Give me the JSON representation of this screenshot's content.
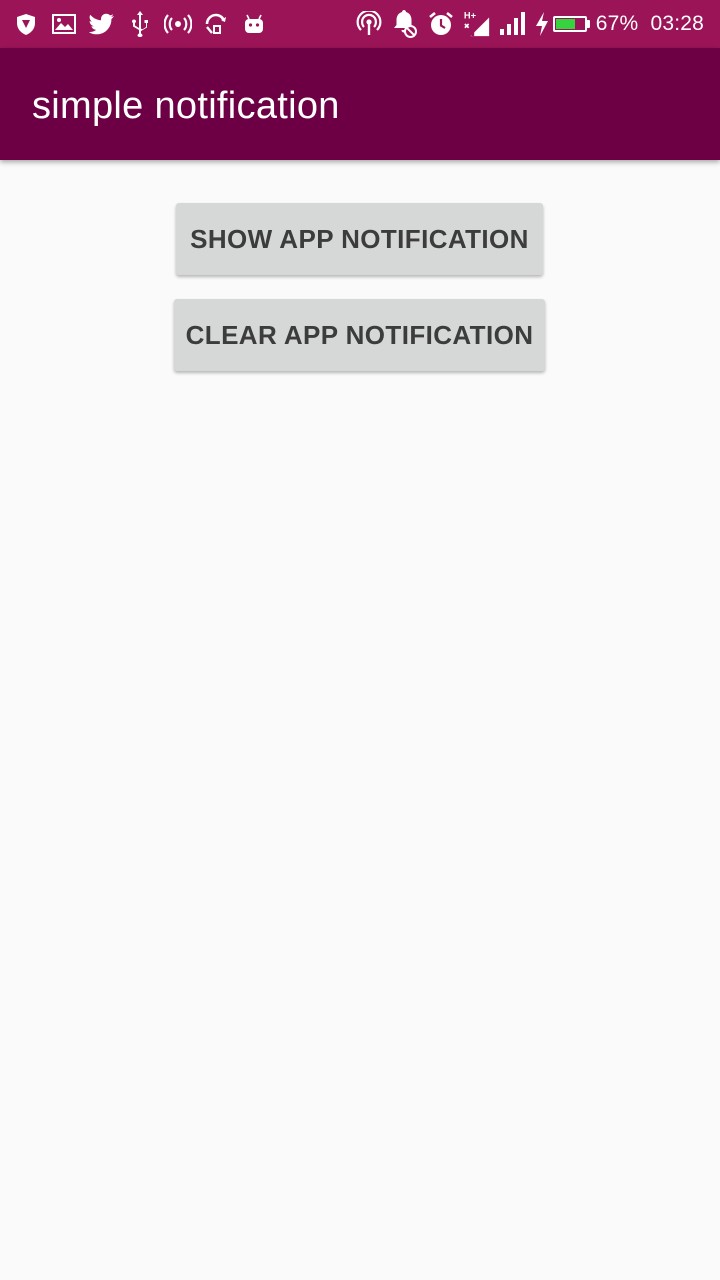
{
  "status_bar": {
    "left_icons": [
      "shield-icon",
      "image-icon",
      "twitter-icon",
      "usb-icon",
      "hotspot-icon",
      "sync-icon",
      "android-icon"
    ],
    "right_icons": [
      "nfc-icon",
      "notifications-off-icon",
      "alarm-icon",
      "hplus-signal-icon",
      "signal-icon",
      "charging-icon"
    ],
    "battery_level": 67,
    "battery_text": "67%",
    "time": "03:28",
    "battery_fill_color": "#35d43f"
  },
  "app_bar": {
    "title": "simple notification"
  },
  "buttons": {
    "show_label": "SHOW APP NOTIFICATION",
    "clear_label": "CLEAR APP NOTIFICATION"
  },
  "colors": {
    "status_bar": "#9c1458",
    "app_bar": "#6d0044",
    "background": "#fafafa",
    "button": "#d6d7d7",
    "button_text": "#3c3c3c"
  }
}
